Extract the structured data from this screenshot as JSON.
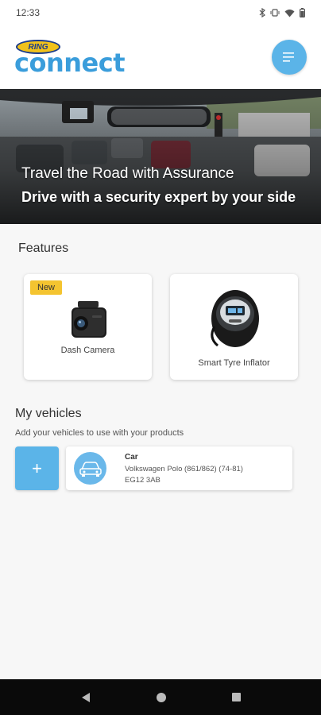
{
  "status_bar": {
    "time": "12:33"
  },
  "header": {
    "logo_ring": "RING",
    "logo_connect": "connect"
  },
  "banner": {
    "line1": "Travel the Road with Assurance",
    "line2": "Drive with a security expert by your side"
  },
  "features": {
    "title": "Features",
    "items": [
      {
        "label": "Dash Camera",
        "badge": "New"
      },
      {
        "label": "Smart Tyre Inflator"
      }
    ]
  },
  "vehicles": {
    "title": "My vehicles",
    "subtitle": "Add your vehicles to use with your products",
    "add_label": "+",
    "items": [
      {
        "type": "Car",
        "model": "Volkswagen Polo (861/862) (74-81)",
        "registration": "EG12 3AB"
      }
    ]
  },
  "colors": {
    "accent": "#5bb4e8",
    "badge": "#f4c430",
    "brand_blue": "#3a9ddb"
  }
}
